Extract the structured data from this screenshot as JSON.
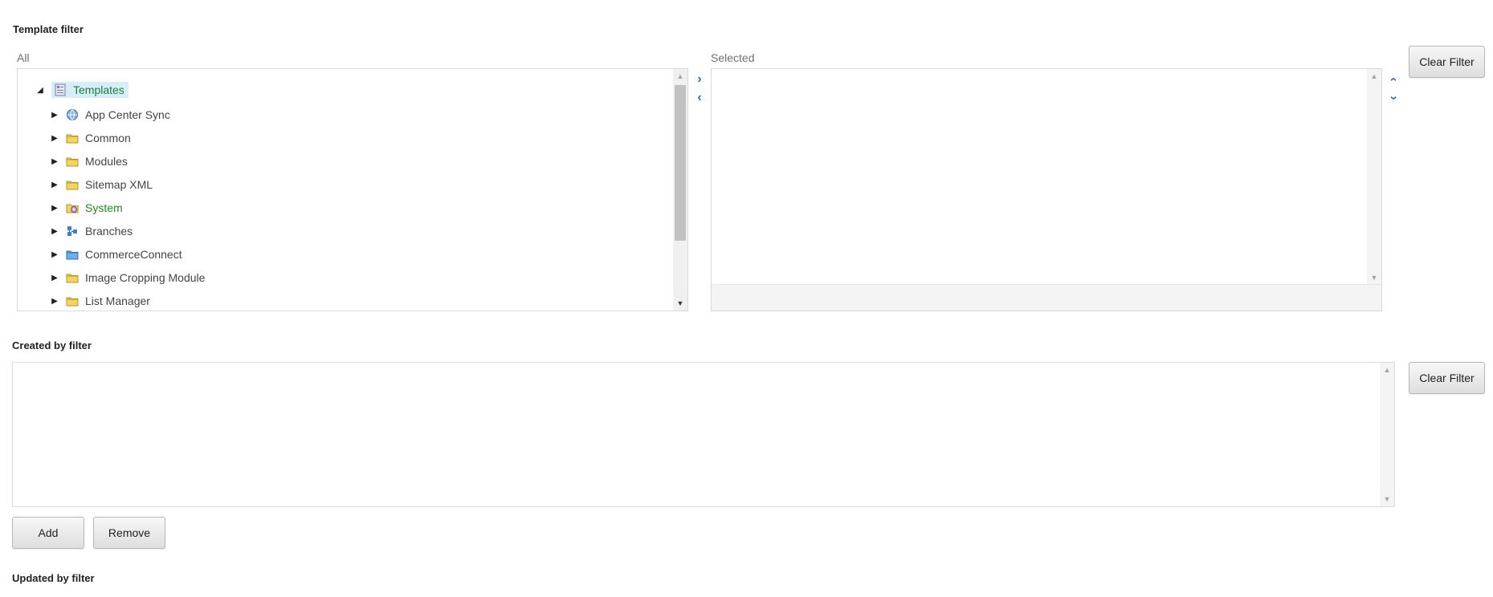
{
  "template_filter": {
    "title": "Template filter",
    "all_label": "All",
    "selected_label": "Selected",
    "clear_label": "Clear Filter",
    "tree": {
      "root": "Templates",
      "items": [
        {
          "label": "App Center Sync",
          "icon": "globe-icon"
        },
        {
          "label": "Common",
          "icon": "folder-icon"
        },
        {
          "label": "Modules",
          "icon": "folder-icon"
        },
        {
          "label": "Sitemap XML",
          "icon": "folder-icon"
        },
        {
          "label": "System",
          "icon": "system-folder-icon"
        },
        {
          "label": "Branches",
          "icon": "branches-icon"
        },
        {
          "label": "CommerceConnect",
          "icon": "blue-folder-icon"
        },
        {
          "label": "Image Cropping Module",
          "icon": "folder-icon"
        },
        {
          "label": "List Manager",
          "icon": "folder-icon"
        }
      ]
    }
  },
  "created_filter": {
    "title": "Created by filter",
    "clear_label": "Clear Filter",
    "add_label": "Add",
    "remove_label": "Remove"
  },
  "updated_filter": {
    "title": "Updated by filter"
  },
  "colors": {
    "accent": "#2f70b3",
    "selected_bg": "#d7edf9",
    "system_text": "#1f8a1f"
  }
}
